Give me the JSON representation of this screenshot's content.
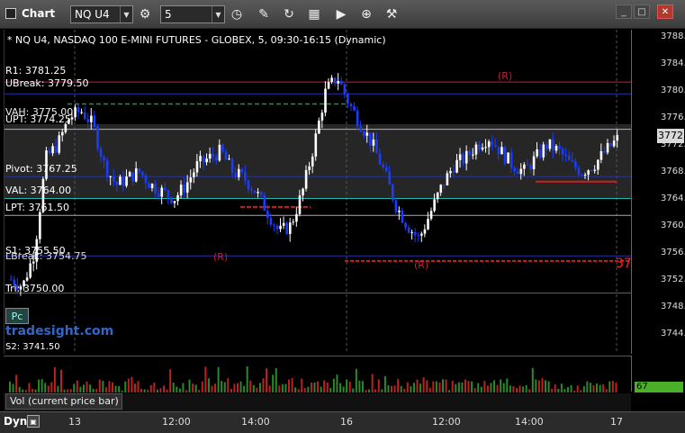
{
  "window": {
    "title": "Chart",
    "symbol": "NQ U4",
    "interval": "5"
  },
  "toolbar": {
    "icons": [
      "gear-icon",
      "clock-icon",
      "pencil-icon",
      "refresh-icon",
      "bar-type-icon",
      "play-icon",
      "add-icon",
      "tools-icon"
    ]
  },
  "chart": {
    "info": "* NQ U4, NASDAQ 100 E-MINI FUTURES - GLOBEX, 5, 09:30-16:15 (Dynamic)",
    "current_price": "3772.75",
    "red_marker": "37",
    "watermark": "tradesight.com",
    "pc_button": "Pc",
    "level_labels": {
      "r1": "R1: 3781.25",
      "ubreak": "UBreak: 3779.50",
      "vah": "VAH: 3775.00",
      "upt": "UPT: 3774.25",
      "pivot": "Pivot: 3767.25",
      "val": "VAL: 3764.00",
      "lpt": "LPT: 3761.50",
      "s1": "S1: 3755.50",
      "lbreak": "LBreak: 3754.75",
      "tri": "Tri: 3750.00",
      "s2": "S2: 3741.50"
    },
    "annotations": {
      "r_top": "(R)",
      "r_mid": "(R)",
      "r_low": "(R)"
    },
    "colors": {
      "up_candle": "#ffffff",
      "down_candle": "#1a3cff",
      "value_area": "#262626",
      "r1_line": "#c0203a",
      "pivot_line": "#2233aa",
      "val_line": "#20b8b0",
      "lbreak_line": "#cc2020",
      "tri_line": "#208040"
    }
  },
  "chart_data": {
    "type": "candlestick",
    "y_axis": {
      "ticks": [
        "3788.00",
        "3784.00",
        "3780.00",
        "3776.00",
        "3772.00",
        "3768.00",
        "3764.00",
        "3760.00",
        "3756.00",
        "3752.00",
        "3748.00",
        "3744.00"
      ],
      "ylim": [
        3741,
        3789
      ]
    },
    "x_axis": {
      "ticks": [
        "13",
        "12:00",
        "14:00",
        "16",
        "12:00",
        "14:00",
        "17"
      ]
    },
    "levels": {
      "r1": 3781.25,
      "ubreak": 3779.5,
      "vah": 3775.0,
      "upt": 3774.25,
      "pivot": 3767.25,
      "val": 3764.0,
      "lpt": 3761.5,
      "s1": 3755.5,
      "lbreak": 3754.75,
      "tri": 3750.0,
      "s2": 3741.5
    },
    "close_path": [
      3752,
      3751,
      3756,
      3770,
      3772,
      3776,
      3777,
      3775,
      3769,
      3766,
      3767,
      3768,
      3766,
      3765,
      3764,
      3766,
      3769,
      3770,
      3771,
      3768,
      3767,
      3765,
      3762,
      3759,
      3760,
      3765,
      3772,
      3780,
      3782,
      3778,
      3775,
      3772,
      3768,
      3763,
      3760,
      3758,
      3762,
      3766,
      3769,
      3770,
      3772,
      3773,
      3771,
      3769,
      3768,
      3770,
      3772,
      3771,
      3769,
      3768,
      3769,
      3771,
      3772.75
    ],
    "volume_value": "67",
    "volume_label": "Vol (current price bar)",
    "footer_label": "Dyn"
  }
}
